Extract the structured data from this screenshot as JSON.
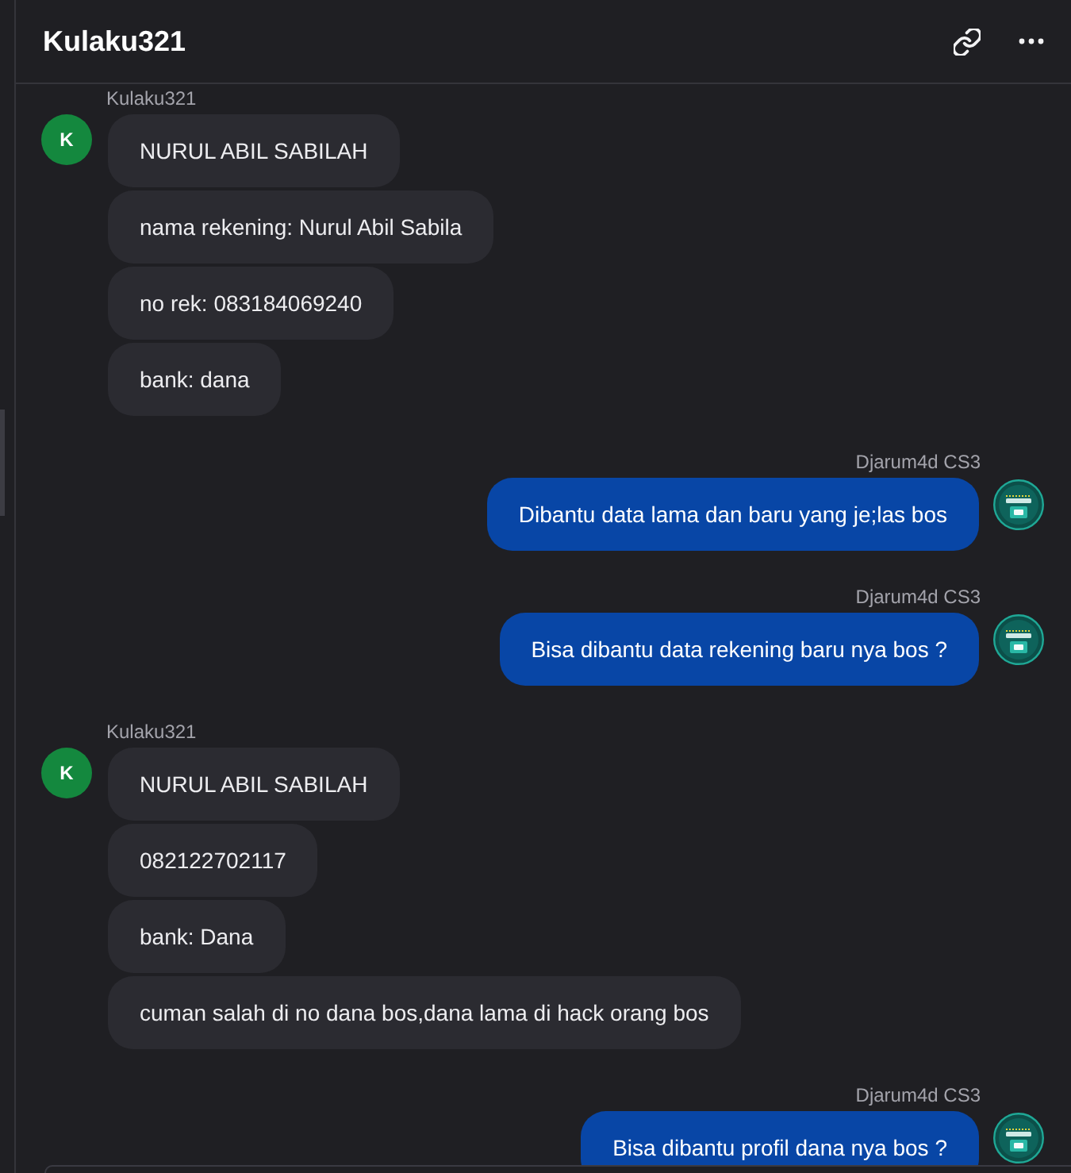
{
  "header": {
    "title": "Kulaku321"
  },
  "messages": [
    {
      "kind": "incoming",
      "sender": "Kulaku321",
      "avatar_letter": "K",
      "texts": [
        "NURUL ABIL SABILAH",
        "nama rekening: Nurul Abil Sabila",
        "no rek: 083184069240",
        "bank: dana"
      ]
    },
    {
      "kind": "outgoing",
      "sender": "Djarum4d CS3",
      "texts": [
        "Dibantu data lama dan baru yang je;las bos"
      ]
    },
    {
      "kind": "outgoing",
      "sender": "Djarum4d CS3",
      "texts": [
        "Bisa dibantu data rekening baru nya bos ?"
      ]
    },
    {
      "kind": "incoming",
      "sender": "Kulaku321",
      "avatar_letter": "K",
      "texts": [
        "NURUL ABIL SABILAH",
        "082122702117",
        "bank: Dana",
        "cuman salah di no dana bos,dana lama di hack orang bos"
      ]
    },
    {
      "kind": "outgoing",
      "sender": "Djarum4d CS3",
      "texts": [
        "Bisa dibantu profil dana nya bos ?"
      ]
    }
  ]
}
